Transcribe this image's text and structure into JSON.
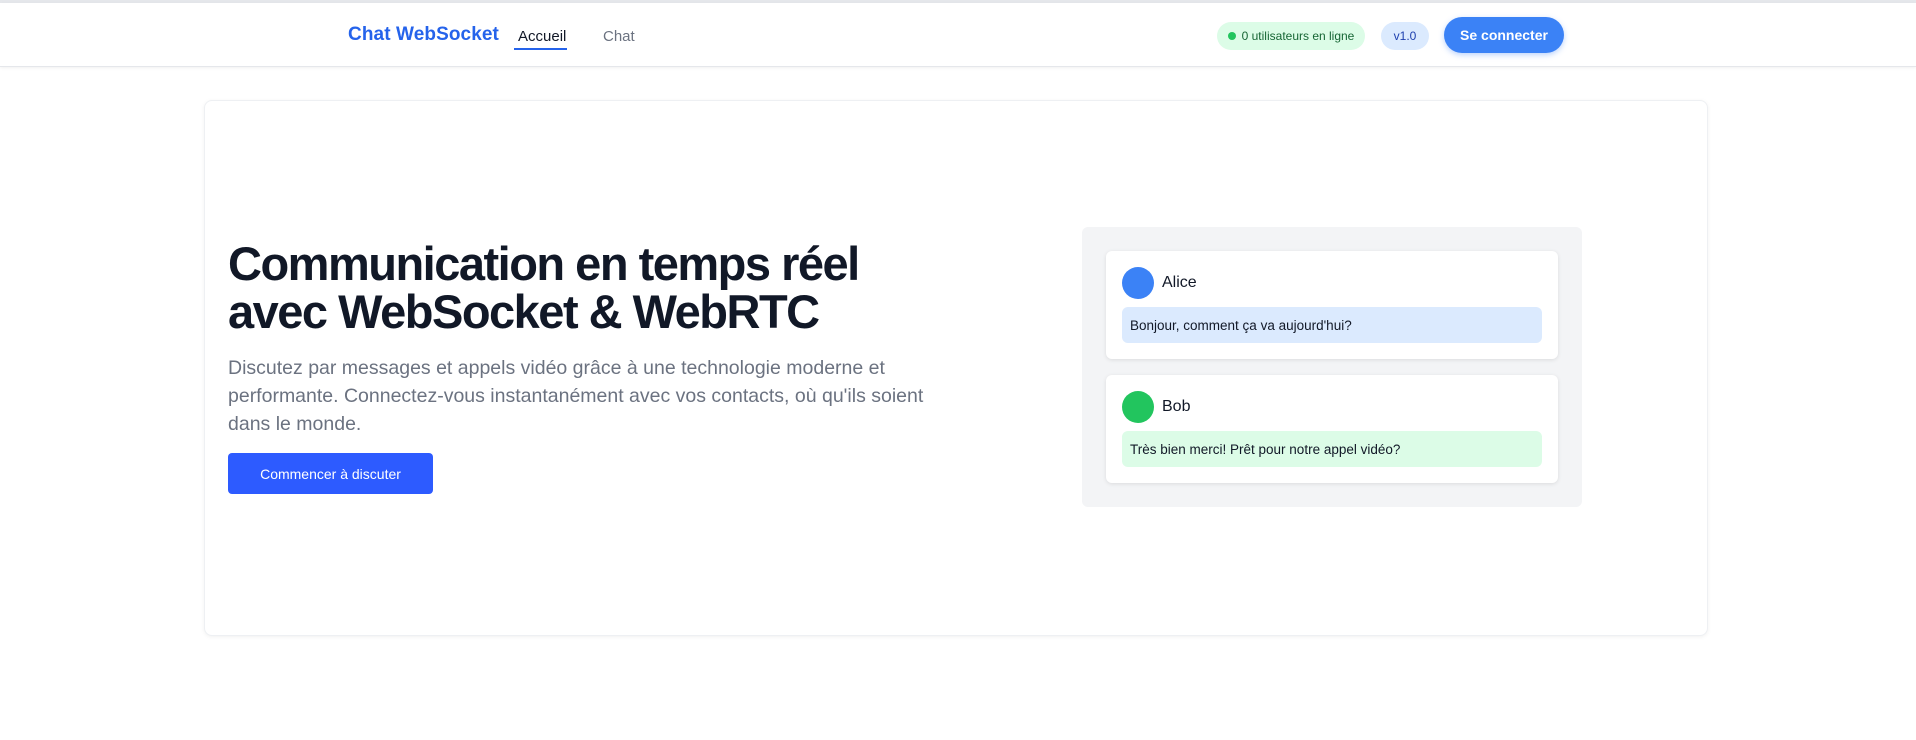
{
  "navbar": {
    "brand": "Chat WebSocket",
    "links": [
      {
        "label": "Accueil",
        "active": true
      },
      {
        "label": "Chat",
        "active": false
      }
    ],
    "online_badge": "0 utilisateurs en ligne",
    "version_badge": "v1.0",
    "login_button": "Se connecter"
  },
  "hero": {
    "title_line1": "Communication en temps réel",
    "title_line2": "avec WebSocket & WebRTC",
    "subtitle": "Discutez par messages et appels vidéo grâce à une technologie moderne et performante. Connectez-vous instantanément avec vos contacts, où qu'ils soient dans le monde.",
    "cta_button": "Commencer à discuter"
  },
  "preview": {
    "messages": [
      {
        "user": "Alice",
        "text": "Bonjour, comment ça va aujourd'hui?",
        "avatar_color": "#3b82f6",
        "bubble_color": "#dbeafe"
      },
      {
        "user": "Bob",
        "text": "Très bien merci! Prêt pour notre appel vidéo?",
        "avatar_color": "#22c55e",
        "bubble_color": "#dcfce7"
      }
    ]
  },
  "colors": {
    "brand": "#2563eb",
    "primary_button": "#3b82f6",
    "cta_button": "#2d5bff",
    "online_dot": "#22c55e"
  }
}
